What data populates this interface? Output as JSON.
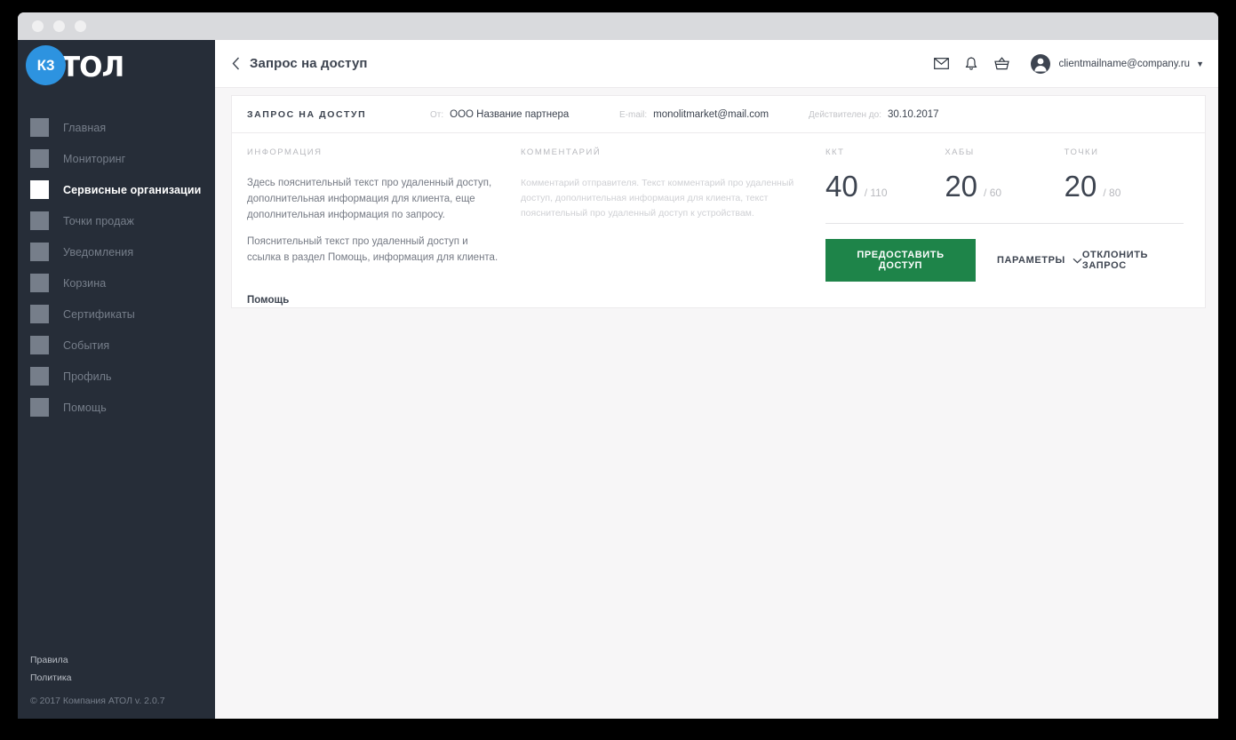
{
  "window": {
    "dots": [
      "close",
      "minimize",
      "maximize"
    ]
  },
  "sidebar": {
    "logo": {
      "wordmark": "АТОЛ",
      "badge": "К3"
    },
    "items": [
      {
        "label": "Главная",
        "icon": "square-placeholder-icon",
        "active": false
      },
      {
        "label": "Мониторинг",
        "icon": "square-placeholder-icon",
        "active": false
      },
      {
        "label": "Сервисные организации",
        "icon": "square-placeholder-icon",
        "active": true
      },
      {
        "label": "Точки продаж",
        "icon": "square-placeholder-icon",
        "active": false
      },
      {
        "label": "Уведомления",
        "icon": "square-placeholder-icon",
        "active": false
      },
      {
        "label": "Корзина",
        "icon": "square-placeholder-icon",
        "active": false
      },
      {
        "label": "Сертификаты",
        "icon": "square-placeholder-icon",
        "active": false
      },
      {
        "label": "События",
        "icon": "square-placeholder-icon",
        "active": false
      },
      {
        "label": "Профиль",
        "icon": "square-placeholder-icon",
        "active": false
      },
      {
        "label": "Помощь",
        "icon": "square-placeholder-icon",
        "active": false
      }
    ],
    "footer": {
      "rules_link": "Правила",
      "policy_link": "Политика",
      "copyright": "© 2017 Компания АТОЛ  v. 2.0.7"
    }
  },
  "topbar": {
    "back_icon": "chevron-left-icon",
    "title": "Запрос на доступ",
    "icons": [
      "mail-icon",
      "bell-icon",
      "basket-icon"
    ],
    "user": {
      "email": "clientmailname@company.ru",
      "avatar_icon": "user-avatar-icon",
      "caret_icon": "caret-down-icon"
    }
  },
  "card": {
    "head": {
      "title": "ЗАПРОС НА ДОСТУП",
      "from_label": "От:",
      "from_value": "ООО Название партнера",
      "email_label": "E-mail:",
      "email_value": "monolitmarket@mail.com",
      "valid_label": "Действителен до:",
      "valid_value": "30.10.2017"
    },
    "info": {
      "section_label": "ИНФОРМАЦИЯ",
      "paragraph_1": "Здесь пояснительный текст про удаленный доступ, дополнительная информация для клиента, еще дополнительная информация по запросу.",
      "paragraph_2": "Пояснительный текст про удаленный доступ и ссылка в раздел Помощь, информация для клиента.",
      "help_link": "Помощь"
    },
    "comment": {
      "section_label": "КОММЕНТАРИЙ",
      "text": "Комментарий отправителя. Текст комментарий про удаленный доступ, дополнительная информация для клиента, текст пояснительный про удаленный доступ к устройствам."
    },
    "stats": [
      {
        "label": "ККТ",
        "current": "40",
        "total": "/ 110"
      },
      {
        "label": "ХАБЫ",
        "current": "20",
        "total": "/ 60"
      },
      {
        "label": "ТОЧКИ",
        "current": "20",
        "total": "/ 80"
      }
    ],
    "actions": {
      "grant_label": "ПРЕДОСТАВИТЬ ДОСТУП",
      "params_label": "ПАРАМЕТРЫ",
      "params_caret_icon": "chevron-down-icon",
      "reject_label": "ОТКЛОНИТЬ ЗАПРОС"
    }
  },
  "colors": {
    "sidebar_bg": "#262d38",
    "accent_green": "#1e8449",
    "badge_blue": "#2d93e0",
    "cursor_blue": "#5aa9e6",
    "page_bg": "#f7f6f7",
    "text_dark": "#3d4450",
    "text_muted": "#757a84"
  },
  "cursor": {
    "icon": "mouse-pointer-icon"
  }
}
